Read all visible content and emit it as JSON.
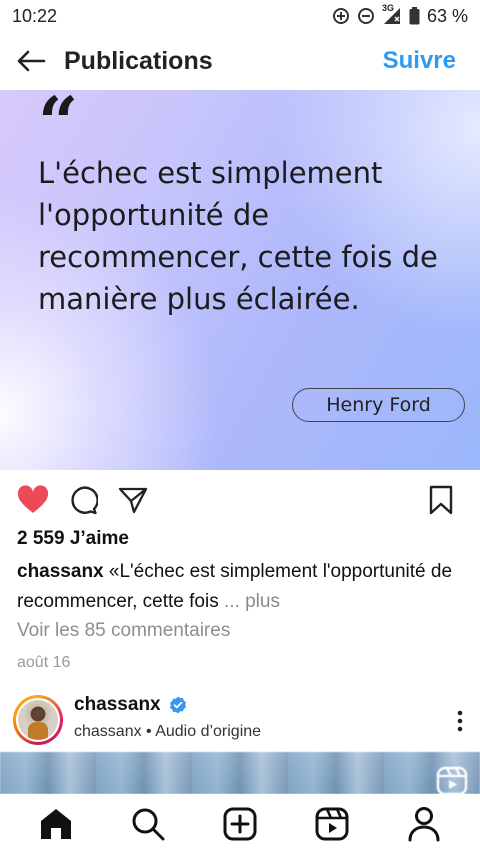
{
  "status_bar": {
    "time": "10:22",
    "network": "3G",
    "battery": "63 %"
  },
  "header": {
    "title": "Publications",
    "follow_label": "Suivre"
  },
  "post": {
    "quote_mark": "“",
    "quote_text": "L'échec est simplement l'opportunité de recommencer, cette fois de manière plus éclairée.",
    "author": "Henry Ford",
    "likes": "2 559 J’aime",
    "caption_user": "chassanx",
    "caption_text": " «L'échec est simplement l'opportunité de recommencer, cette fois",
    "caption_more": " ... plus",
    "comments_link": "Voir les 85 commentaires",
    "date": "août 16"
  },
  "next_post": {
    "username": "chassanx",
    "subtitle": "chassanx • Audio d’origine"
  },
  "colors": {
    "accent": "#2f9bf0",
    "like_red": "#ed4956"
  }
}
